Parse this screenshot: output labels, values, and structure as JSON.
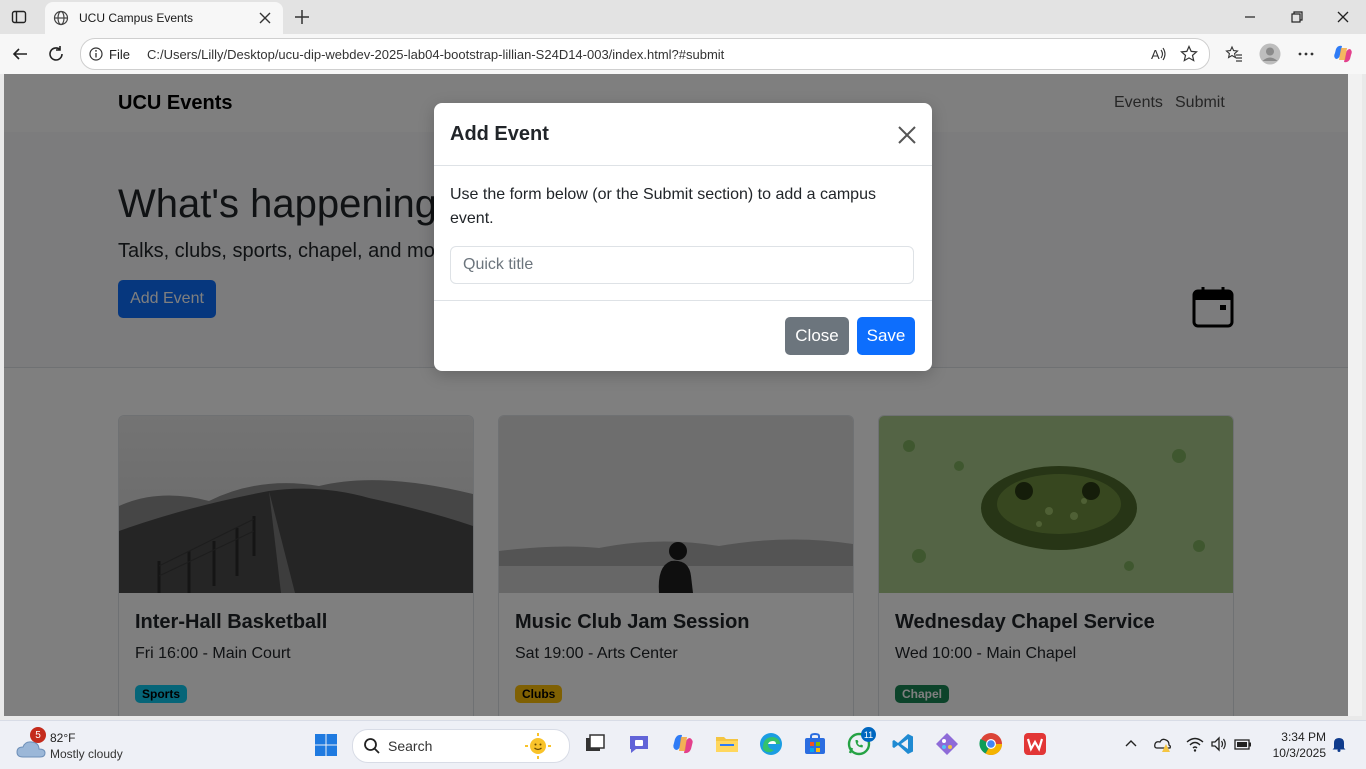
{
  "browser": {
    "tab_title": "UCU Campus Events",
    "address_label": "File",
    "url": "C:/Users/Lilly/Desktop/ucu-dip-webdev-2025-lab04-bootstrap-lillian-S24D14-003/index.html?#submit"
  },
  "site": {
    "brand": "UCU Events",
    "nav": [
      "Events",
      "Submit"
    ],
    "hero_title": "What's happening on campus",
    "hero_lead": "Talks, clubs, sports, chapel, and more—all in one place.",
    "hero_button": "Add Event",
    "calendar_icon": "calendar-icon"
  },
  "cards": [
    {
      "title": "Inter-Hall Basketball",
      "meta": "Fri 16:00 - Main Court",
      "badge": "Sports",
      "badge_color": "#0dcaf0"
    },
    {
      "title": "Music Club Jam Session",
      "meta": "Sat 19:00 - Arts Center",
      "badge": "Clubs",
      "badge_color": "#ffc107"
    },
    {
      "title": "Wednesday Chapel Service",
      "meta": "Wed 10:00 - Main Chapel",
      "badge": "Chapel",
      "badge_color": "#198754"
    }
  ],
  "modal": {
    "title": "Add Event",
    "body": "Use the form below (or the Submit section) to add a campus event.",
    "input_placeholder": "Quick title",
    "input_value": "",
    "close_button": "Close",
    "save_button": "Save"
  },
  "taskbar": {
    "weather_temp": "82°F",
    "weather_condition": "Mostly cloudy",
    "weather_badge": "5",
    "search_label": "Search",
    "whatsapp_badge": "11",
    "time": "3:34 PM",
    "date": "10/3/2025"
  },
  "colors": {
    "primary": "#0d6efd",
    "secondary": "#6c757d"
  }
}
